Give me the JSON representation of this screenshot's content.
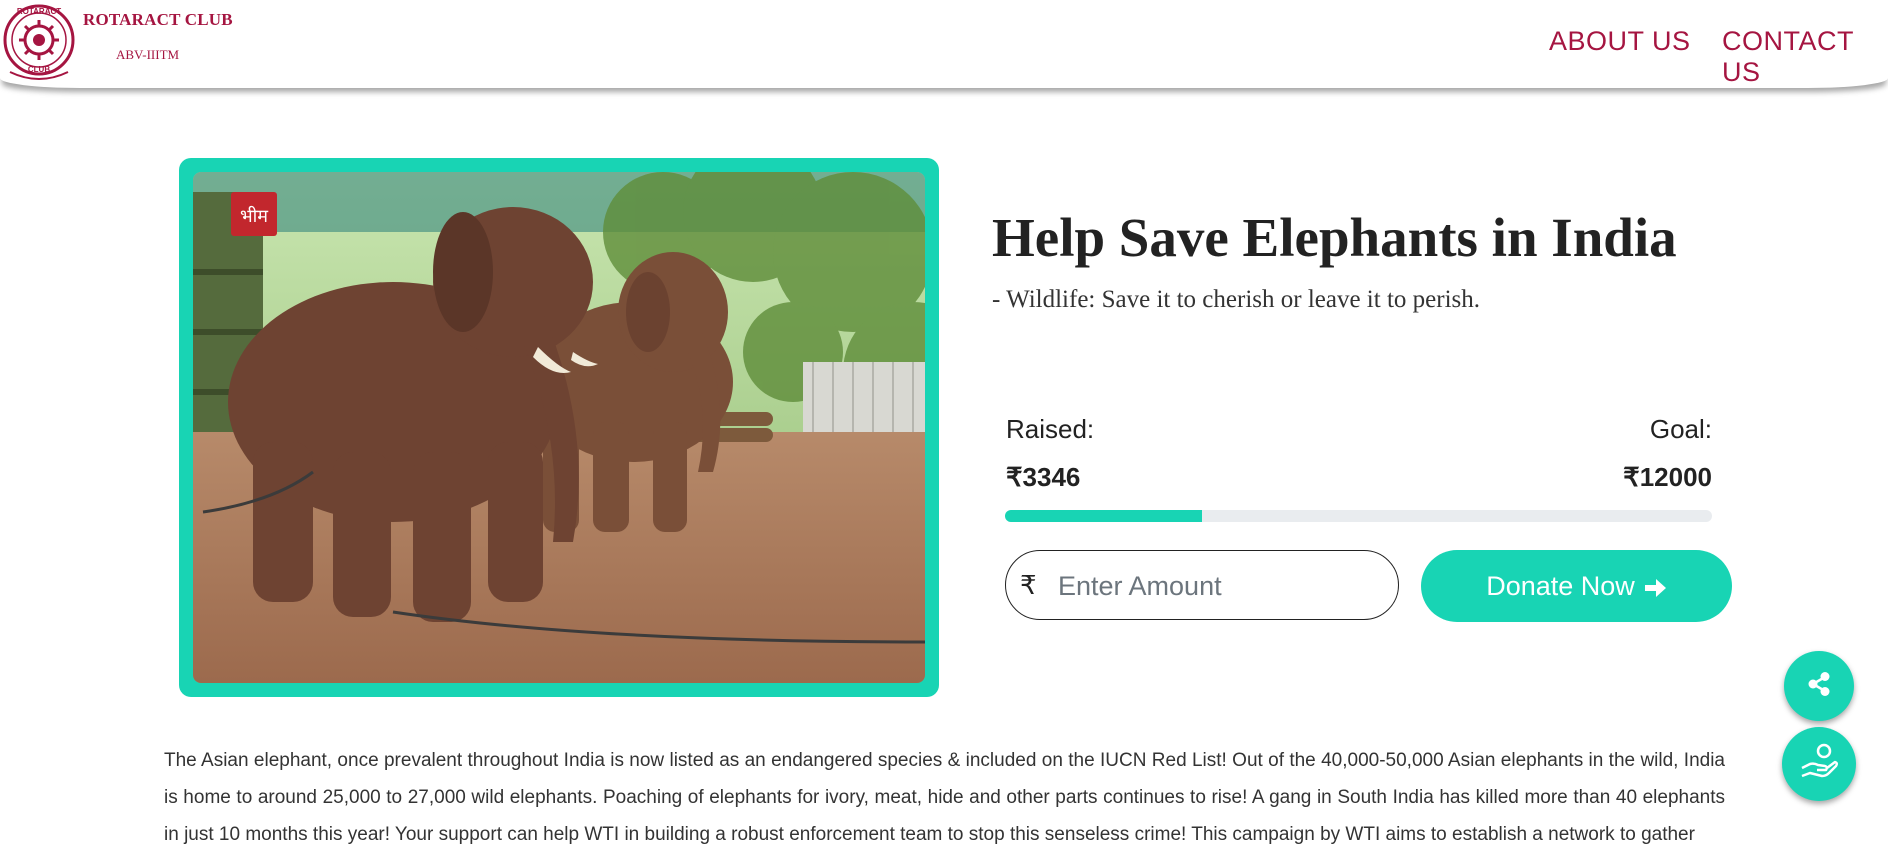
{
  "header": {
    "brand_title": "ROTARACT CLUB",
    "brand_subtitle": "ABV-IIITM",
    "logo_text": "ROTARACT CLUB",
    "nav": [
      {
        "label": "ABOUT US"
      },
      {
        "label": "CONTACT US"
      }
    ]
  },
  "hero": {
    "image_alt": "Two elephants standing in a compound",
    "sign_text": "भीम"
  },
  "campaign": {
    "title": "Help Save Elephants in India",
    "tagline": "- Wildlife: Save it to cherish or leave it to perish.",
    "raised_label": "Raised:",
    "goal_label": "Goal:",
    "raised_value": "₹3346",
    "goal_value": "₹12000",
    "progress_fraction": 0.279,
    "currency_symbol": "₹",
    "amount_placeholder": "Enter Amount",
    "donate_label": "Donate Now"
  },
  "floating": {
    "share_icon": "share-icon",
    "donate_icon": "donate-hand-icon"
  },
  "description": "The Asian elephant, once prevalent throughout India is now listed as an endangered species & included on the IUCN Red List! Out of the 40,000-50,000 Asian elephants in the wild, India is home to around 25,000 to 27,000 wild elephants. Poaching of elephants for ivory, meat, hide and other parts continues to rise! A gang in South India has killed more than 40 elephants in just 10 months this year! Your support can help WTI in building a robust enforcement team to stop this senseless crime! This campaign by WTI aims to establish a network to gather",
  "colors": {
    "accent": "#18d4b4",
    "brand": "#a51541",
    "text": "#222222"
  }
}
